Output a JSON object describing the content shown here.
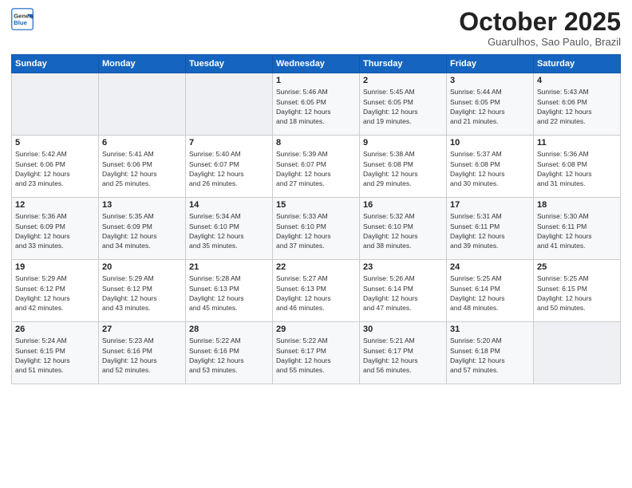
{
  "header": {
    "logo_line1": "General",
    "logo_line2": "Blue",
    "month": "October 2025",
    "location": "Guarulhos, Sao Paulo, Brazil"
  },
  "weekdays": [
    "Sunday",
    "Monday",
    "Tuesday",
    "Wednesday",
    "Thursday",
    "Friday",
    "Saturday"
  ],
  "weeks": [
    [
      {
        "day": "",
        "info": ""
      },
      {
        "day": "",
        "info": ""
      },
      {
        "day": "",
        "info": ""
      },
      {
        "day": "1",
        "info": "Sunrise: 5:46 AM\nSunset: 6:05 PM\nDaylight: 12 hours\nand 18 minutes."
      },
      {
        "day": "2",
        "info": "Sunrise: 5:45 AM\nSunset: 6:05 PM\nDaylight: 12 hours\nand 19 minutes."
      },
      {
        "day": "3",
        "info": "Sunrise: 5:44 AM\nSunset: 6:05 PM\nDaylight: 12 hours\nand 21 minutes."
      },
      {
        "day": "4",
        "info": "Sunrise: 5:43 AM\nSunset: 6:06 PM\nDaylight: 12 hours\nand 22 minutes."
      }
    ],
    [
      {
        "day": "5",
        "info": "Sunrise: 5:42 AM\nSunset: 6:06 PM\nDaylight: 12 hours\nand 23 minutes."
      },
      {
        "day": "6",
        "info": "Sunrise: 5:41 AM\nSunset: 6:06 PM\nDaylight: 12 hours\nand 25 minutes."
      },
      {
        "day": "7",
        "info": "Sunrise: 5:40 AM\nSunset: 6:07 PM\nDaylight: 12 hours\nand 26 minutes."
      },
      {
        "day": "8",
        "info": "Sunrise: 5:39 AM\nSunset: 6:07 PM\nDaylight: 12 hours\nand 27 minutes."
      },
      {
        "day": "9",
        "info": "Sunrise: 5:38 AM\nSunset: 6:08 PM\nDaylight: 12 hours\nand 29 minutes."
      },
      {
        "day": "10",
        "info": "Sunrise: 5:37 AM\nSunset: 6:08 PM\nDaylight: 12 hours\nand 30 minutes."
      },
      {
        "day": "11",
        "info": "Sunrise: 5:36 AM\nSunset: 6:08 PM\nDaylight: 12 hours\nand 31 minutes."
      }
    ],
    [
      {
        "day": "12",
        "info": "Sunrise: 5:36 AM\nSunset: 6:09 PM\nDaylight: 12 hours\nand 33 minutes."
      },
      {
        "day": "13",
        "info": "Sunrise: 5:35 AM\nSunset: 6:09 PM\nDaylight: 12 hours\nand 34 minutes."
      },
      {
        "day": "14",
        "info": "Sunrise: 5:34 AM\nSunset: 6:10 PM\nDaylight: 12 hours\nand 35 minutes."
      },
      {
        "day": "15",
        "info": "Sunrise: 5:33 AM\nSunset: 6:10 PM\nDaylight: 12 hours\nand 37 minutes."
      },
      {
        "day": "16",
        "info": "Sunrise: 5:32 AM\nSunset: 6:10 PM\nDaylight: 12 hours\nand 38 minutes."
      },
      {
        "day": "17",
        "info": "Sunrise: 5:31 AM\nSunset: 6:11 PM\nDaylight: 12 hours\nand 39 minutes."
      },
      {
        "day": "18",
        "info": "Sunrise: 5:30 AM\nSunset: 6:11 PM\nDaylight: 12 hours\nand 41 minutes."
      }
    ],
    [
      {
        "day": "19",
        "info": "Sunrise: 5:29 AM\nSunset: 6:12 PM\nDaylight: 12 hours\nand 42 minutes."
      },
      {
        "day": "20",
        "info": "Sunrise: 5:29 AM\nSunset: 6:12 PM\nDaylight: 12 hours\nand 43 minutes."
      },
      {
        "day": "21",
        "info": "Sunrise: 5:28 AM\nSunset: 6:13 PM\nDaylight: 12 hours\nand 45 minutes."
      },
      {
        "day": "22",
        "info": "Sunrise: 5:27 AM\nSunset: 6:13 PM\nDaylight: 12 hours\nand 46 minutes."
      },
      {
        "day": "23",
        "info": "Sunrise: 5:26 AM\nSunset: 6:14 PM\nDaylight: 12 hours\nand 47 minutes."
      },
      {
        "day": "24",
        "info": "Sunrise: 5:25 AM\nSunset: 6:14 PM\nDaylight: 12 hours\nand 48 minutes."
      },
      {
        "day": "25",
        "info": "Sunrise: 5:25 AM\nSunset: 6:15 PM\nDaylight: 12 hours\nand 50 minutes."
      }
    ],
    [
      {
        "day": "26",
        "info": "Sunrise: 5:24 AM\nSunset: 6:15 PM\nDaylight: 12 hours\nand 51 minutes."
      },
      {
        "day": "27",
        "info": "Sunrise: 5:23 AM\nSunset: 6:16 PM\nDaylight: 12 hours\nand 52 minutes."
      },
      {
        "day": "28",
        "info": "Sunrise: 5:22 AM\nSunset: 6:16 PM\nDaylight: 12 hours\nand 53 minutes."
      },
      {
        "day": "29",
        "info": "Sunrise: 5:22 AM\nSunset: 6:17 PM\nDaylight: 12 hours\nand 55 minutes."
      },
      {
        "day": "30",
        "info": "Sunrise: 5:21 AM\nSunset: 6:17 PM\nDaylight: 12 hours\nand 56 minutes."
      },
      {
        "day": "31",
        "info": "Sunrise: 5:20 AM\nSunset: 6:18 PM\nDaylight: 12 hours\nand 57 minutes."
      },
      {
        "day": "",
        "info": ""
      }
    ]
  ]
}
